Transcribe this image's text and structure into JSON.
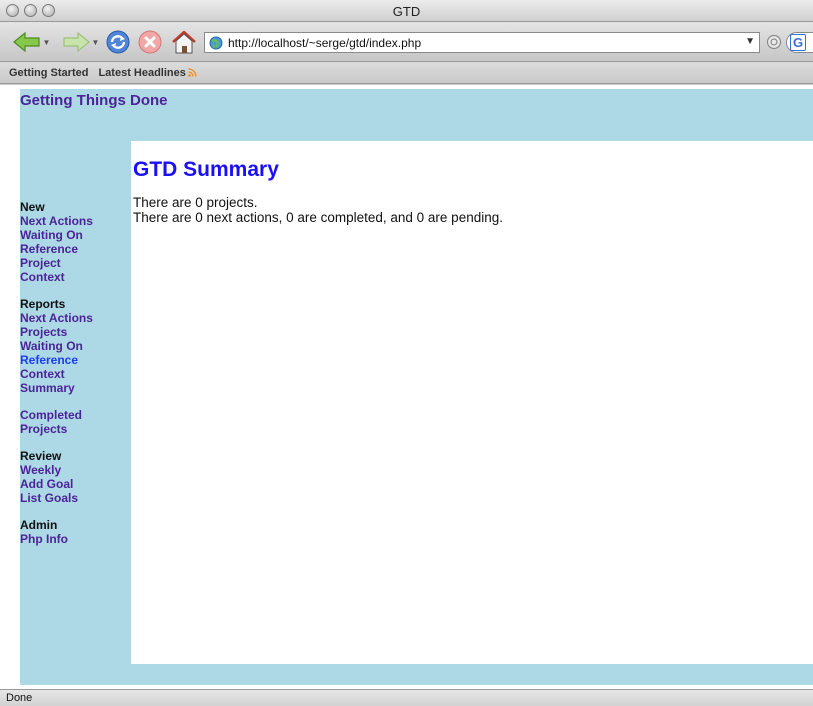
{
  "window": {
    "title": "GTD"
  },
  "toolbar": {
    "url": "http://localhost/~serge/gtd/index.php",
    "search_engine_letter": "G"
  },
  "bookmarks": [
    {
      "label": "Getting Started"
    },
    {
      "label": "Latest Headlines"
    }
  ],
  "page": {
    "site_title": "Getting Things Done",
    "heading": "GTD Summary",
    "summary_lines": [
      "There are 0 projects.",
      "There are 0 next actions, 0 are completed, and 0 are pending."
    ]
  },
  "sidebar": {
    "groups": [
      {
        "heading": "New",
        "links": [
          "Next Actions",
          "Waiting On",
          "Reference",
          "Project",
          "Context"
        ]
      },
      {
        "heading": "Reports",
        "links": [
          "Next Actions",
          "Projects",
          "Waiting On",
          "Reference",
          "Context",
          "Summary"
        ]
      },
      {
        "heading": "",
        "links": [
          "Completed",
          "Projects"
        ]
      },
      {
        "heading": "Review",
        "links": [
          "Weekly",
          "Add Goal",
          "List Goals"
        ]
      },
      {
        "heading": "Admin",
        "links": [
          "Php Info"
        ]
      }
    ]
  },
  "status": {
    "text": "Done"
  },
  "colors": {
    "page_background": "#add8e6",
    "link_visited": "#4b2597",
    "link_active": "#1a3df0",
    "heading": "#1a0ff5"
  }
}
